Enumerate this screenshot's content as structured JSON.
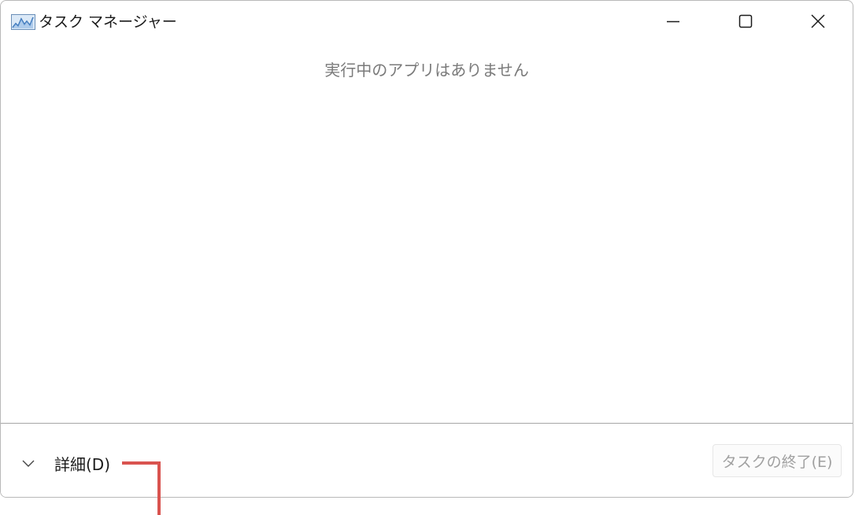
{
  "window": {
    "title": "タスク マネージャー",
    "buttons": {
      "minimize_icon": "minimize-icon",
      "maximize_icon": "maximize-icon",
      "close_icon": "close-icon"
    }
  },
  "main": {
    "empty_message": "実行中のアプリはありません"
  },
  "footer": {
    "details_label": "詳細(D)",
    "details_icon": "chevron-down-icon",
    "end_task_label": "タスクの終了(E)"
  },
  "colors": {
    "annotation": "#d9534f",
    "disabled_text": "#a0a0a0"
  }
}
